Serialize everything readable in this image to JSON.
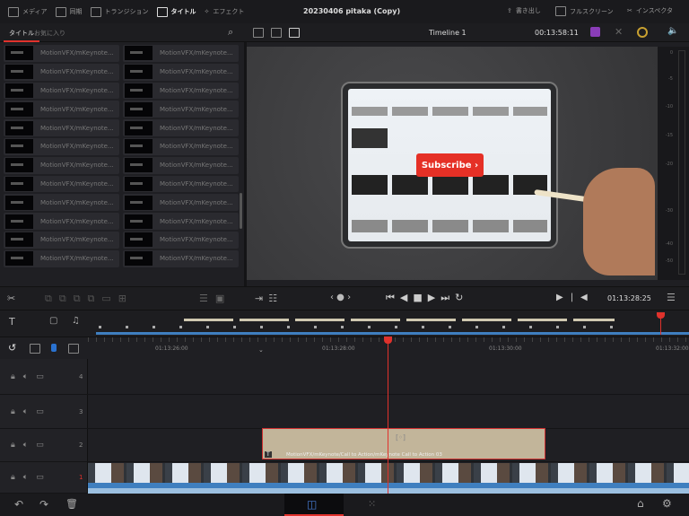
{
  "topbar": {
    "tabs": [
      {
        "label": "メディア",
        "icon": "media-icon"
      },
      {
        "label": "同期",
        "icon": "sync-icon"
      },
      {
        "label": "トランジション",
        "icon": "transition-icon"
      },
      {
        "label": "タイトル",
        "icon": "title-icon",
        "active": true
      },
      {
        "label": "エフェクト",
        "icon": "effects-icon"
      }
    ],
    "project_title": "20230406 pitaka (Copy)",
    "export": "書き出し",
    "fullscreen": "フルスクリーン",
    "inspector": "インスペクタ"
  },
  "left_panel": {
    "tabs": [
      "タイトル",
      "お気に入り"
    ],
    "items": [
      "MotionVFX/mKeynote...",
      "MotionVFX/mKeynote...",
      "MotionVFX/mKeynote...",
      "MotionVFX/mKeynote...",
      "MotionVFX/mKeynote...",
      "MotionVFX/mKeynote...",
      "MotionVFX/mKeynote...",
      "MotionVFX/mKeynote...",
      "MotionVFX/mKeynote...",
      "MotionVFX/mKeynote...",
      "MotionVFX/mKeynote...",
      "MotionVFX/mKeynote...",
      "MotionVFX/mKeynote...",
      "MotionVFX/mKeynote...",
      "MotionVFX/mKeynote...",
      "MotionVFX/mKeynote...",
      "MotionVFX/mKeynote...",
      "MotionVFX/mKeynote...",
      "MotionVFX/mKeynote...",
      "MotionVFX/mKeynote...",
      "MotionVFX/mKeynote...",
      "MotionVFX/mKeynote...",
      "MotionVFX/mKeynote...",
      "MotionVFX/mKeynote..."
    ]
  },
  "viewer": {
    "timeline_name": "Timeline 1",
    "duration": "00:13:58:11",
    "subscribe_label": "Subscribe ›",
    "meter_labels": [
      "0",
      "-5",
      "-10",
      "-15",
      "-20",
      "-30",
      "-40",
      "-50"
    ]
  },
  "transport": {
    "timecode": "01:13:28:25"
  },
  "ruler": {
    "labels": [
      "01:13:26:00",
      "01:13:28:00",
      "01:13:30:00",
      "01:13:32:00"
    ]
  },
  "tracks": [
    {
      "num": "4"
    },
    {
      "num": "3"
    },
    {
      "num": "2"
    },
    {
      "num": "1"
    }
  ],
  "clip": {
    "label": "MotionVFX/mKeynote/Call to Action/mKeynote Call to Action 03",
    "color": "#c2b59a"
  },
  "colors": {
    "accent": "#e0322c",
    "playhead": "#e0322c",
    "audio": "#3f7fbf"
  }
}
